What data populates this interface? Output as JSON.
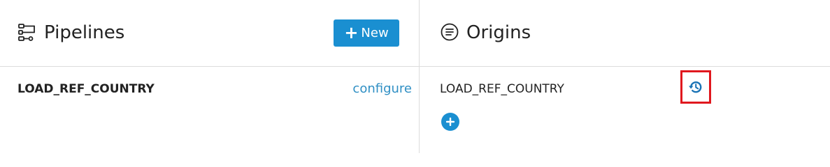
{
  "pipelines": {
    "title": "Pipelines",
    "icon": "pipeline-icon",
    "new_button": {
      "icon": "plus-icon",
      "label": "New"
    },
    "items": [
      {
        "name": "LOAD_REF_COUNTRY",
        "action_label": "configure"
      }
    ]
  },
  "origins": {
    "title": "Origins",
    "icon": "list-circle-icon",
    "items": [
      {
        "name": "LOAD_REF_COUNTRY",
        "history_icon": "history-icon"
      }
    ],
    "add_icon": "plus-circle-icon"
  },
  "colors": {
    "accent": "#1a8fd1",
    "link": "#2f8fc4",
    "highlight_border": "#e0181e",
    "divider": "#dcdcdc",
    "text": "#222222"
  }
}
